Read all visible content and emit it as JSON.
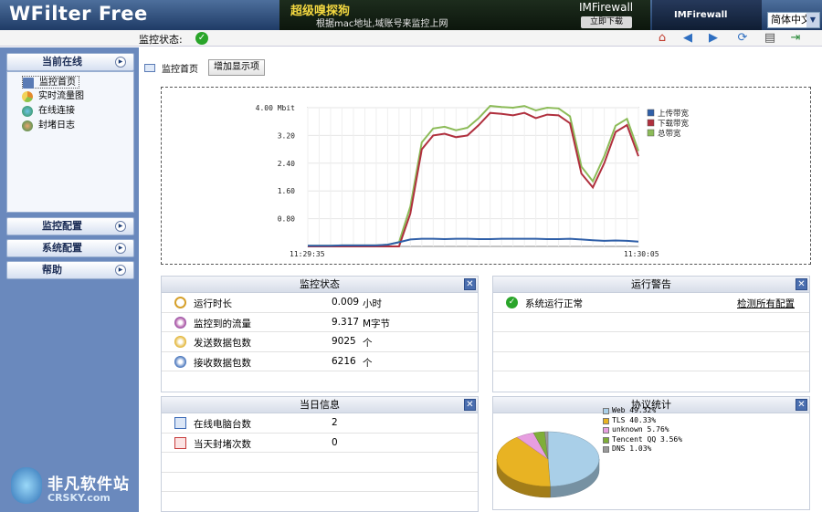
{
  "app": {
    "title": "WFilter Free",
    "banner": {
      "headline": "超级嗅探狗",
      "subline": "根据mac地址,域账号来监控上网",
      "brand": "IMFirewall",
      "download": "立即下载"
    },
    "banner2": "IMFirewall",
    "language": "简体中文"
  },
  "toolbar": {
    "status_label": "监控状态:",
    "icons": [
      "home-icon",
      "back-icon",
      "forward-icon",
      "refresh-icon",
      "print-icon",
      "exit-icon"
    ]
  },
  "sidebar": {
    "sections": [
      {
        "label": "当前在线"
      },
      {
        "label": "监控配置"
      },
      {
        "label": "系统配置"
      },
      {
        "label": "帮助"
      }
    ],
    "items": [
      {
        "label": "监控首页",
        "icon": "monitor-icon",
        "color": "#5a7bb5"
      },
      {
        "label": "实时流量图",
        "icon": "chart-icon",
        "color": "#e48a2c"
      },
      {
        "label": "在线连接",
        "icon": "globe-icon",
        "color": "#2f8f4a"
      },
      {
        "label": "封堵日志",
        "icon": "block-icon",
        "color": "#2f8f4a"
      }
    ],
    "watermark": {
      "name": "非凡软件站",
      "site": "CRSKY.com"
    }
  },
  "main": {
    "tab_label": "监控首页",
    "add_button": "增加显示项"
  },
  "chart_data": {
    "type": "line",
    "ylabel": "Mbit",
    "yticks": [
      "0.80",
      "1.60",
      "2.40",
      "3.20",
      "4.00"
    ],
    "ylim": [
      0,
      4.0
    ],
    "x_labels": [
      "11:29:35",
      "11:30:05"
    ],
    "x": [
      0,
      1,
      2,
      3,
      4,
      5,
      6,
      7,
      8,
      9,
      10,
      11,
      12,
      13,
      14,
      15,
      16,
      17,
      18,
      19,
      20,
      21,
      22,
      23,
      24,
      25,
      26,
      27,
      28,
      29
    ],
    "series": [
      {
        "name": "上传带宽",
        "color": "#2f5fa8",
        "values": [
          0.02,
          0.02,
          0.02,
          0.03,
          0.03,
          0.03,
          0.03,
          0.05,
          0.12,
          0.2,
          0.22,
          0.22,
          0.21,
          0.22,
          0.22,
          0.21,
          0.21,
          0.22,
          0.22,
          0.22,
          0.22,
          0.21,
          0.21,
          0.22,
          0.2,
          0.18,
          0.16,
          0.17,
          0.16,
          0.14
        ]
      },
      {
        "name": "下载带宽",
        "color": "#b0303e",
        "values": [
          0.0,
          0.0,
          0.0,
          0.0,
          0.0,
          0.0,
          0.0,
          0.0,
          0.0,
          0.95,
          2.8,
          3.2,
          3.25,
          3.15,
          3.2,
          3.5,
          3.85,
          3.82,
          3.78,
          3.85,
          3.7,
          3.8,
          3.78,
          3.55,
          2.1,
          1.7,
          2.4,
          3.3,
          3.5,
          2.6
        ]
      },
      {
        "name": "总带宽",
        "color": "#8cbb58",
        "values": [
          0.02,
          0.02,
          0.02,
          0.03,
          0.03,
          0.03,
          0.03,
          0.05,
          0.12,
          1.15,
          3.0,
          3.4,
          3.45,
          3.35,
          3.42,
          3.7,
          4.05,
          4.02,
          4.0,
          4.05,
          3.92,
          4.0,
          3.98,
          3.75,
          2.3,
          1.88,
          2.6,
          3.48,
          3.68,
          2.75
        ]
      }
    ]
  },
  "panels": {
    "monitor_status": {
      "title": "监控状态",
      "rows": [
        {
          "label": "运行时长",
          "value": "0.009",
          "unit": "小时",
          "icon": "clock-icon",
          "color": "#d6a02a"
        },
        {
          "label": "监控到的流量",
          "value": "9.317",
          "unit": "M字节",
          "icon": "traffic-icon",
          "color": "#b05aa8"
        },
        {
          "label": "发送数据包数",
          "value": "9025",
          "unit": "个",
          "icon": "send-packet-icon",
          "color": "#e0b02a"
        },
        {
          "label": "接收数据包数",
          "value": "6216",
          "unit": "个",
          "icon": "receive-packet-icon",
          "color": "#3c6cb8"
        }
      ]
    },
    "alerts": {
      "title": "运行警告",
      "rows": [
        {
          "label": "系统运行正常",
          "action": "检测所有配置",
          "icon": "ok-icon"
        }
      ]
    },
    "daily": {
      "title": "当日信息",
      "rows": [
        {
          "label": "在线电脑台数",
          "value": "2",
          "icon": "computer-icon",
          "color": "#3c6cb8"
        },
        {
          "label": "当天封堵次数",
          "value": "0",
          "icon": "block-count-icon",
          "color": "#c83c3c"
        }
      ]
    },
    "protocols": {
      "title": "协议统计",
      "chart_data": {
        "type": "pie",
        "categories": [
          "Web",
          "TLS",
          "unknown",
          "Tencent QQ",
          "DNS"
        ],
        "values": [
          49.32,
          40.33,
          5.76,
          3.56,
          1.03
        ],
        "labels": [
          "Web 49.32%",
          "TLS 40.33%",
          "unknown 5.76%",
          "Tencent QQ 3.56%",
          "DNS 1.03%"
        ],
        "colors": [
          "#a9cfe8",
          "#e8b323",
          "#e79ee0",
          "#7fae38",
          "#9a9a9a"
        ]
      }
    }
  }
}
